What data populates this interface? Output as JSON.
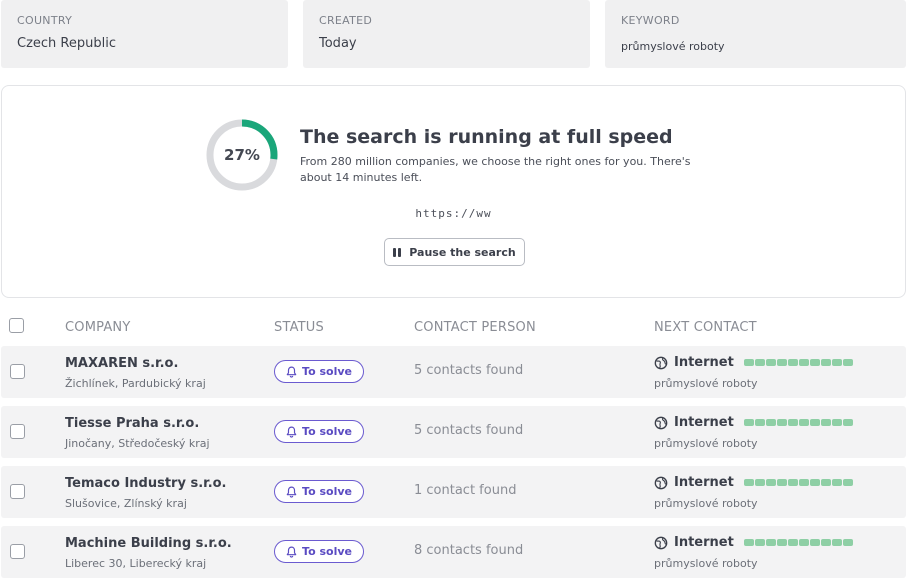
{
  "filters": {
    "country": {
      "label": "COUNTRY",
      "value": "Czech Republic"
    },
    "created": {
      "label": "CREATED",
      "value": "Today"
    },
    "keyword": {
      "label": "KEYWORD",
      "value": "průmyslové roboty"
    }
  },
  "search": {
    "progress_percent": 27,
    "progress_label": "27%",
    "title": "The search is running at full speed",
    "description": "From 280 million companies, we choose the right ones for you. There's about 14 minutes left.",
    "url": "https://ww",
    "pause_label": "Pause the search"
  },
  "table": {
    "headers": {
      "company": "COMPANY",
      "status": "STATUS",
      "contact_person": "CONTACT PERSON",
      "next_contact": "NEXT CONTACT"
    },
    "rows": [
      {
        "name": "MAXAREN s.r.o.",
        "location": "Žichlínek, Pardubický kraj",
        "status": "To solve",
        "contacts": "5 contacts found",
        "channel": "Internet",
        "keyword": "průmyslové roboty"
      },
      {
        "name": "Tiesse Praha s.r.o.",
        "location": "Jinočany, Středočeský kraj",
        "status": "To solve",
        "contacts": "5 contacts found",
        "channel": "Internet",
        "keyword": "průmyslové roboty"
      },
      {
        "name": "Temaco Industry s.r.o.",
        "location": "Slušovice, Zlínský kraj",
        "status": "To solve",
        "contacts": "1 contact found",
        "channel": "Internet",
        "keyword": "průmyslové roboty"
      },
      {
        "name": "Machine Building s.r.o.",
        "location": "Liberec 30, Liberecký kraj",
        "status": "To solve",
        "contacts": "8 contacts found",
        "channel": "Internet",
        "keyword": "průmyslové roboty"
      }
    ]
  },
  "colors": {
    "progress_fill": "#1aa67a",
    "progress_track": "#d9dadd",
    "status_accent": "#5a4bc2",
    "bar_fill": "#8ecfa5"
  },
  "icons": {
    "status": "bell-icon",
    "channel": "globe-icon",
    "pause": "pause-icon"
  }
}
